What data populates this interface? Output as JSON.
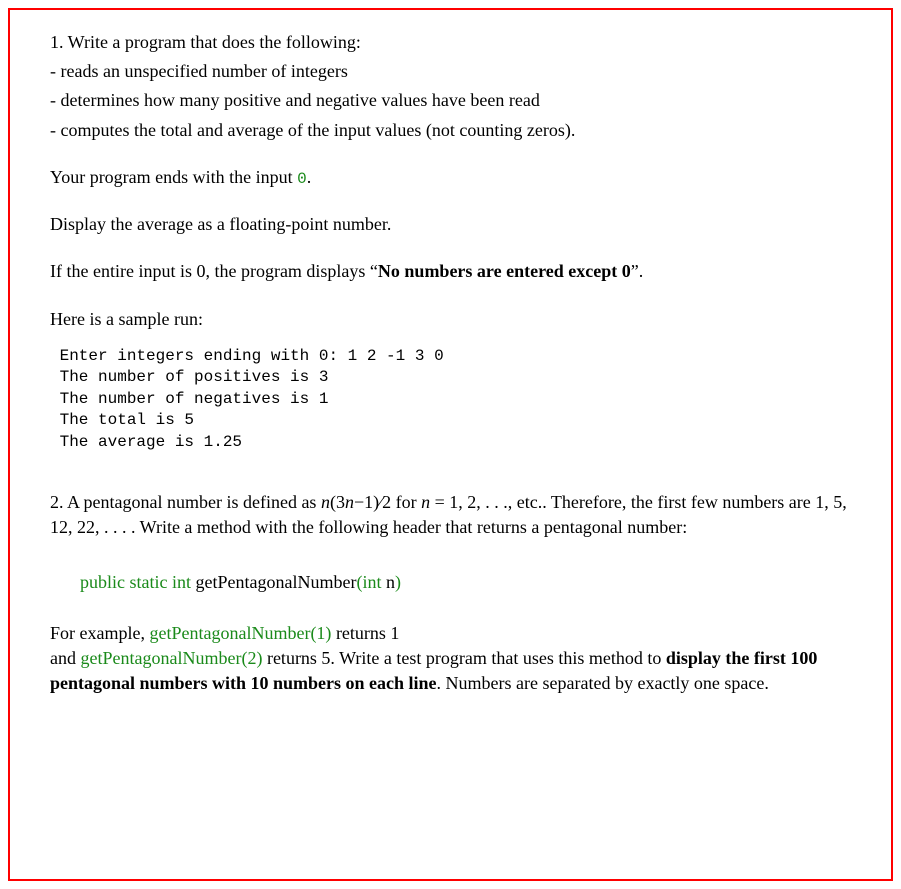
{
  "q1": {
    "heading": "1. Write a program that does the following:",
    "bullet1": "- reads an unspecified number of integers",
    "bullet2": "- determines how many positive and negative values have been read",
    "bullet3": "- computes the total and average of the input values (not counting zeros).",
    "endsWithPre": "Your program ends with the input ",
    "zero": "0",
    "endsWithPost": ".",
    "displayAvg": "Display the average as a floating-point number.",
    "ifZeroPre": " If the entire input is 0, the program displays “",
    "ifZeroBold": "No numbers are entered except 0",
    "ifZeroPost": "”.",
    "sampleRunLabel": "Here is a sample run:",
    "sample": {
      "line1": " Enter integers ending with 0: 1 2 -1 3 0",
      "line2": " The number of positives is 3",
      "line3": " The number of negatives is 1",
      "line4": " The total is 5",
      "line5": " The average is 1.25"
    }
  },
  "q2": {
    "intro": {
      "pre": "2. A pentagonal number is defined as ",
      "formula_n": "n",
      "formula_mid1": "(3",
      "formula_n2": "n",
      "formula_mid2": "−1)⁄2  for ",
      "formula_n3": "n",
      "formula_post": " = 1, 2, . . ., etc.. Therefore, the first few numbers are 1, 5, 12, 22, . . . . Write a method with the following header that returns a pentagonal number:"
    },
    "sig": {
      "publicStaticInt": "public static int",
      "space1": " ",
      "methodName": "getPentagonalNumber",
      "parenOpen": "(",
      "intKw": "int",
      "space2": " ",
      "param": "n",
      "parenClose": ")"
    },
    "example": {
      "pre": "For example, ",
      "call1": "getPentagonalNumber(1)",
      "ret1": " returns 1",
      "andPre": "and ",
      "call2": "getPentagonalNumber(2)",
      "ret2": " returns 5. Write a test program that uses this method to ",
      "bold": "display the first 100 pentagonal numbers with 10 numbers on each line",
      "post": ". Numbers are separated by exactly one space."
    }
  }
}
